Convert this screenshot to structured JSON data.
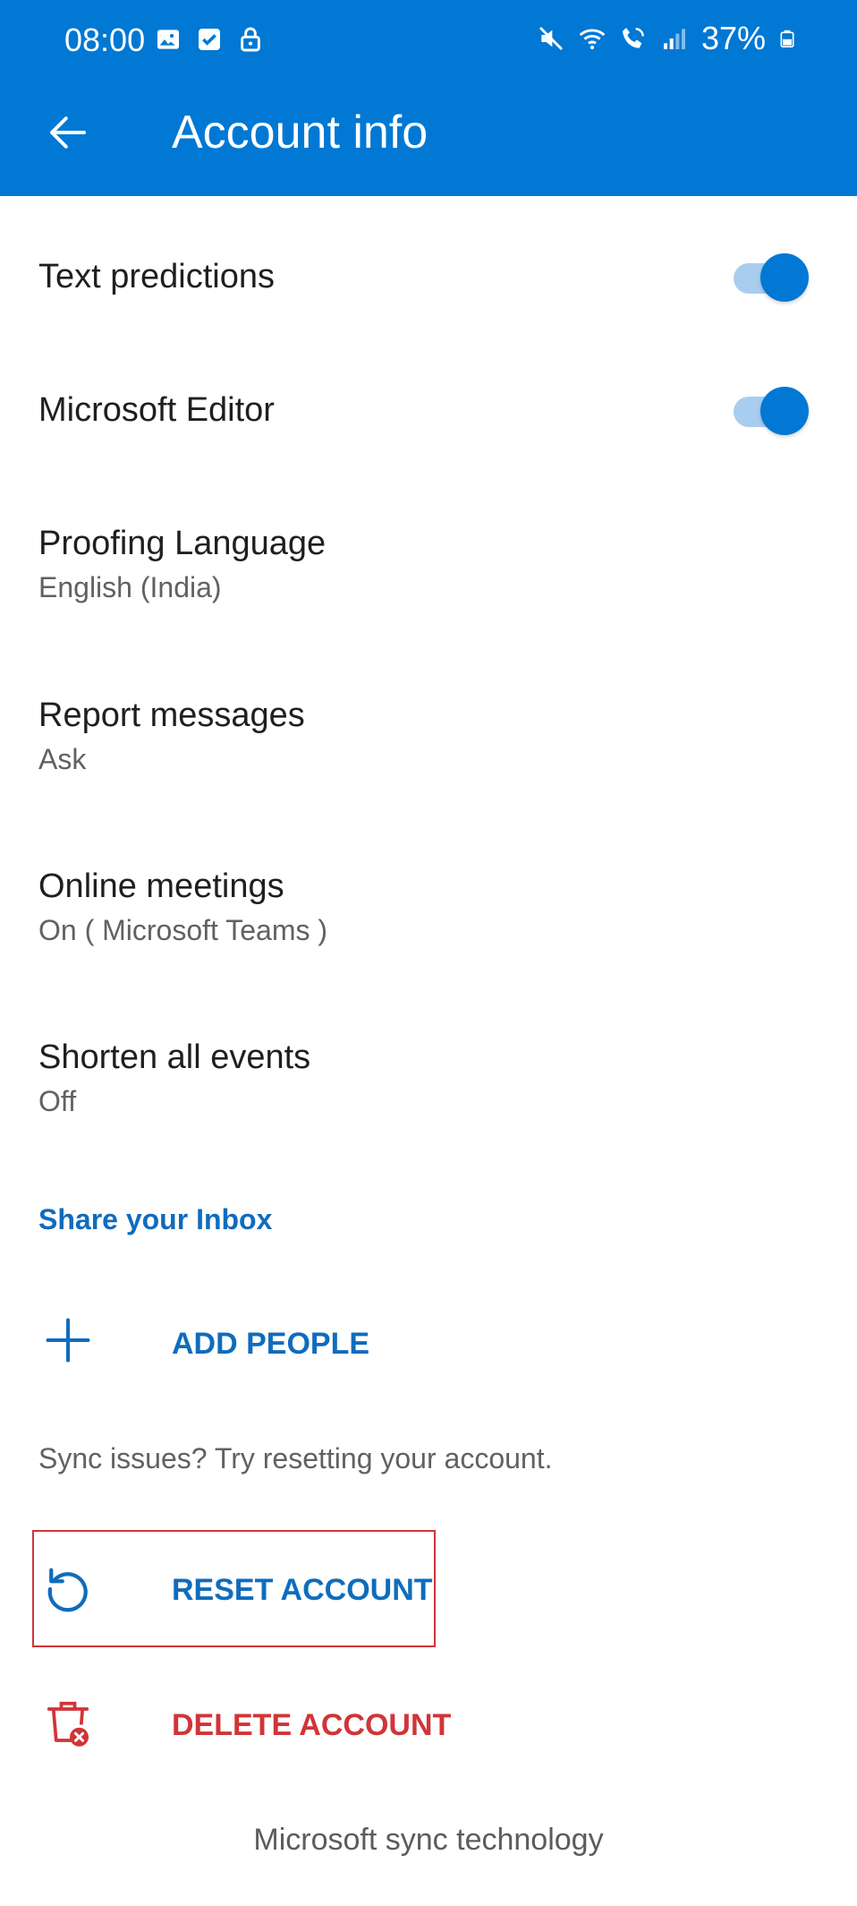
{
  "status_bar": {
    "time": "08:00",
    "battery": "37%",
    "left_icons": [
      "gallery-icon",
      "checkbox-icon",
      "lock-icon"
    ],
    "right_icons": [
      "mute-icon",
      "wifi-icon",
      "wifi-calling-icon",
      "signal-icon",
      "battery-icon"
    ]
  },
  "header": {
    "title": "Account info",
    "back_icon": "arrow-back-icon"
  },
  "settings": {
    "text_predictions": {
      "label": "Text predictions",
      "enabled": true
    },
    "microsoft_editor": {
      "label": "Microsoft Editor",
      "enabled": true
    },
    "proofing_language": {
      "label": "Proofing Language",
      "value": "English (India)"
    },
    "report_messages": {
      "label": "Report messages",
      "value": "Ask"
    },
    "online_meetings": {
      "label": "Online meetings",
      "value": "On ( Microsoft Teams )"
    },
    "shorten_events": {
      "label": "Shorten all events",
      "value": "Off"
    }
  },
  "share_inbox": {
    "heading": "Share your Inbox",
    "add_people_label": "ADD PEOPLE"
  },
  "sync": {
    "hint": "Sync issues? Try resetting your account.",
    "reset_label": "RESET ACCOUNT",
    "delete_label": "DELETE ACCOUNT"
  },
  "footer": {
    "text": "Microsoft sync technology"
  },
  "colors": {
    "accent": "#0078d4",
    "link": "#0f6cbd",
    "danger": "#d13438",
    "toggle_track": "#a9cdef"
  }
}
